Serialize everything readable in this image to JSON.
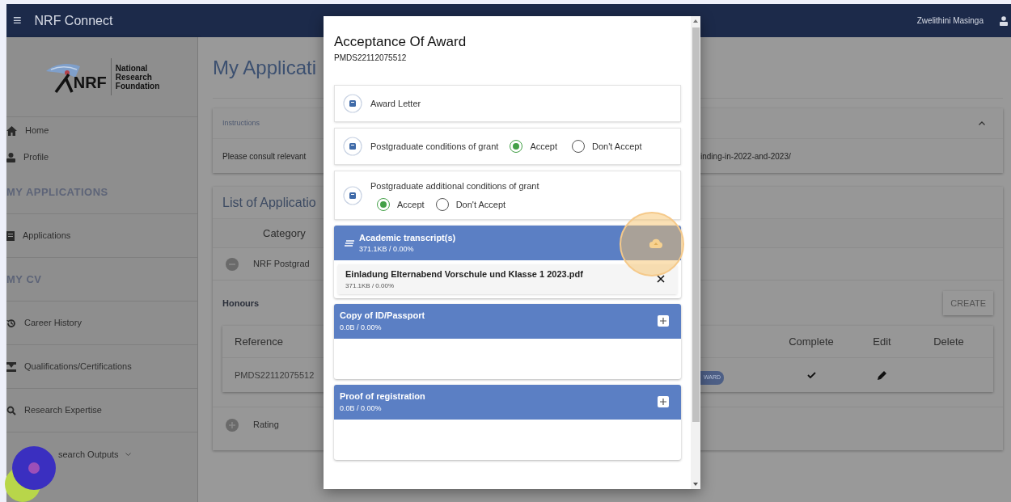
{
  "top_bar": {
    "menu_glyph": "≡",
    "title": "NRF Connect",
    "user": "Zwelithini Masinga"
  },
  "logo": {
    "mark": "NRF",
    "lines": [
      "National",
      "Research",
      "Foundation"
    ]
  },
  "sidebar": {
    "items": [
      {
        "kind": "link",
        "label": "Home"
      },
      {
        "kind": "link",
        "label": "Profile"
      },
      {
        "kind": "section",
        "label": "MY APPLICATIONS"
      },
      {
        "kind": "link",
        "label": "Applications"
      },
      {
        "kind": "section",
        "label": "MY CV"
      },
      {
        "kind": "link",
        "label": "Career History"
      },
      {
        "kind": "link",
        "label": "Qualifications/Certifications"
      },
      {
        "kind": "link",
        "label": "Research Expertise"
      },
      {
        "kind": "dropdown",
        "label": "search Outputs"
      }
    ]
  },
  "page_title": "My Applicati",
  "instructions": {
    "title": "Instructions",
    "text_left": "Please consult relevant",
    "text_right": "inding-in-2022-and-2023/",
    "expanded": true
  },
  "applications": {
    "title": "List of Applicatio",
    "column_header": "Category",
    "groups": [
      {
        "label": "NRF Postgrad",
        "expanded": true
      },
      {
        "label": "Rating",
        "expanded": false
      }
    ],
    "subgroup": "Honours",
    "create_button": "CREATE",
    "table": {
      "columns": [
        "Reference",
        "Complete",
        "Edit",
        "Delete"
      ],
      "rows": [
        {
          "reference": "PMDS22112075512",
          "badge": "WARD",
          "complete": true
        }
      ]
    }
  },
  "modal": {
    "title": "Acceptance Of Award",
    "subtitle": "PMDS22112075512",
    "documents": [
      {
        "kind": "plain",
        "label": "Award Letter"
      },
      {
        "kind": "inline_choice",
        "label": "Postgraduate conditions of grant",
        "options": [
          {
            "label": "Accept",
            "selected": true
          },
          {
            "label": "Don't Accept",
            "selected": false
          }
        ]
      },
      {
        "kind": "stacked_choice",
        "label": "Postgraduate additional conditions of grant",
        "options": [
          {
            "label": "Accept",
            "selected": true
          },
          {
            "label": "Don't Accept",
            "selected": false
          }
        ]
      }
    ],
    "uploads": [
      {
        "title": "Academic transcript(s)",
        "size": "371.1KB / 0.00%",
        "files": [
          {
            "name": "Einladung Elternabend Vorschule und Klasse 1 2023.pdf",
            "size": "371.1KB / 0.00%"
          }
        ]
      },
      {
        "title": "Copy of ID/Passport",
        "size": "0.0B / 0.00%"
      },
      {
        "title": "Proof of registration",
        "size": "0.0B / 0.00%"
      }
    ]
  }
}
